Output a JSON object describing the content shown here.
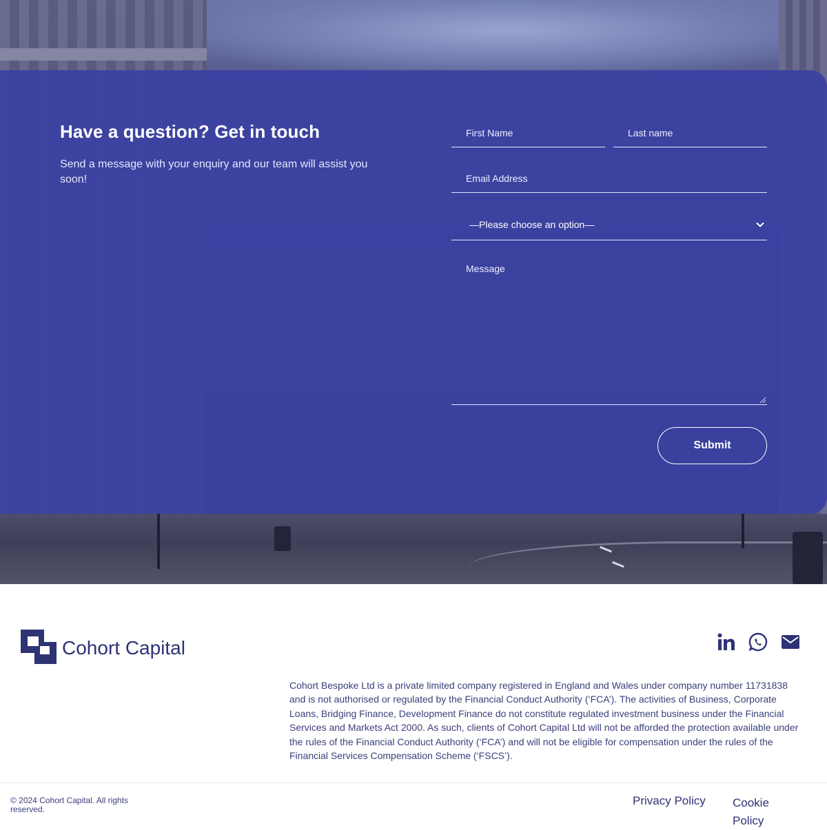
{
  "contact": {
    "title": "Have a question? Get in touch",
    "subtitle": "Send a message with your enquiry and our team will assist you soon!",
    "first_name_placeholder": "First Name",
    "last_name_placeholder": "Last name",
    "email_placeholder": "Email Address",
    "enquiry_select_value": "—Please choose an option—",
    "message_placeholder": "Message",
    "submit_label": "Submit"
  },
  "footer": {
    "brand": "Cohort Capital",
    "social_icons": [
      "linkedin-icon",
      "whatsapp-icon",
      "mail-icon"
    ],
    "disclaimer": "Cohort Bespoke Ltd is a private limited company registered in England and Wales under company number 11731838 and is not authorised or regulated by the Financial Conduct Authority (‘FCA’). The activities of Business, Corporate Loans, Bridging Finance, Development Finance do not constitute regulated investment business under the Financial Services and Markets Act 2000. As such, clients of Cohort Capital Ltd will not be afforded the protection available under the rules of the Financial Conduct Authority (‘FCA’) and will not be eligible for compensation under the rules of the Financial Services Compensation Scheme (‘FSCS’).",
    "copyright": "© 2024 Cohort Capital. All rights reserved.",
    "privacy_link": "Privacy Policy",
    "cookie_link": "Cookie Policy"
  },
  "colors": {
    "panel": "#3a40a2",
    "brand": "#2e3374",
    "text_light": "#ffffff"
  }
}
